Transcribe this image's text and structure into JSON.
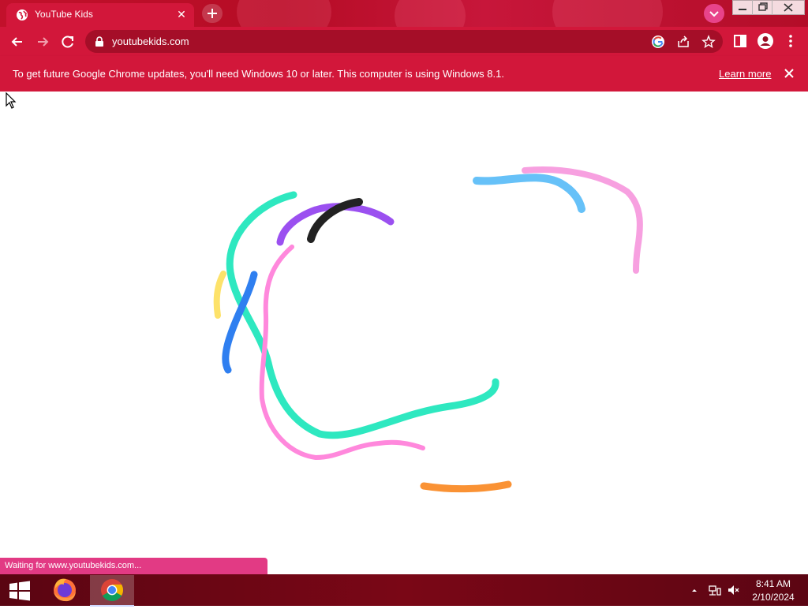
{
  "browser": {
    "tab": {
      "title": "YouTube Kids",
      "close_glyph": "✕"
    },
    "address_bar": {
      "url": "youtubekids.com"
    },
    "icons": [
      "globe-icon",
      "plus-icon",
      "chevron-down-icon",
      "back-arrow-icon",
      "forward-arrow-icon",
      "reload-icon",
      "lock-icon",
      "google-icon",
      "share-icon",
      "star-icon",
      "side-panel-icon",
      "profile-icon",
      "menu-icon"
    ]
  },
  "infobar": {
    "message": "To get future Google Chrome updates, you'll need Windows 10 or later. This computer is using Windows 8.1.",
    "link": "Learn more"
  },
  "page": {
    "status_text": "Waiting for www.youtubekids.com...",
    "stroke_colors": [
      "#2ee8c0",
      "#ff88dc",
      "#9b50f0",
      "#222222",
      "#2f7ff0",
      "#fde26a",
      "#66c1f8",
      "#f7a0e0",
      "#fa9234"
    ]
  },
  "taskbar": {
    "apps": [
      "start-button",
      "firefox",
      "chrome"
    ],
    "tray": {
      "time": "8:41 AM",
      "date": "2/10/2024"
    }
  },
  "colors": {
    "theme_red": "#d2173a",
    "omnibox": "#a50e28",
    "status_pink": "#e23a84",
    "taskbar": "#6a0614"
  }
}
